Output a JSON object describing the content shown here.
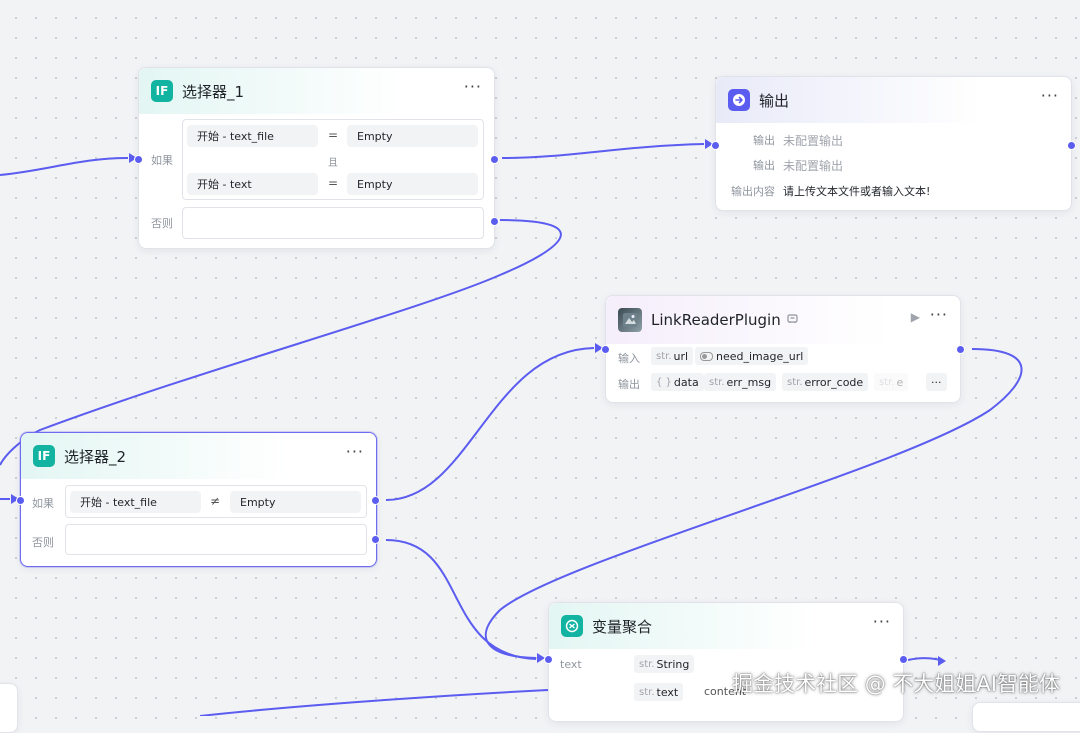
{
  "colors": {
    "accent": "#5b5cf0",
    "edge": "#5b5cf0",
    "if_icon": "#13b3a1"
  },
  "selector1": {
    "icon": "IF",
    "title": "选择器_1",
    "more": "···",
    "if_label": "如果",
    "and_label": "且",
    "else_label": "否则",
    "conditions": [
      {
        "left": "开始  -  text_file",
        "op": "=",
        "right": "Empty"
      },
      {
        "left": "开始  -  text",
        "op": "=",
        "right": "Empty"
      }
    ]
  },
  "output_node": {
    "title": "输出",
    "more": "···",
    "rows": [
      {
        "label": "输出",
        "value": "未配置输出"
      },
      {
        "label": "输出",
        "value": "未配置输出"
      },
      {
        "label": "输出内容",
        "value": "请上传文本文件或者输入文本!"
      }
    ]
  },
  "plugin": {
    "title": "LinkReaderPlugin",
    "badge_icon": "plugin-badge-icon",
    "run_icon": "▶",
    "more": "···",
    "input_label": "输入",
    "output_label": "输出",
    "inputs": [
      {
        "type": "str.",
        "name": "url"
      },
      {
        "type": "toggle",
        "name": "need_image_url"
      }
    ],
    "outputs": [
      {
        "type": "{ }",
        "name": "data"
      },
      {
        "type": "str.",
        "name": "err_msg"
      },
      {
        "type": "str.",
        "name": "error_code"
      },
      {
        "type": "str.",
        "name": "e"
      }
    ],
    "overflow": "···"
  },
  "selector2": {
    "icon": "IF",
    "title": "选择器_2",
    "more": "···",
    "if_label": "如果",
    "else_label": "否则",
    "condition": {
      "left": "开始  -  text_file",
      "op": "≠",
      "right": "Empty"
    }
  },
  "aggregator": {
    "title": "变量聚合",
    "more": "···",
    "var_label": "text",
    "tags": [
      {
        "type": "str.",
        "name": "String"
      },
      {
        "type": "str.",
        "name": "text"
      }
    ],
    "extra": "content"
  },
  "watermark": "掘金技术社区 @ 不大姐姐AI智能体"
}
